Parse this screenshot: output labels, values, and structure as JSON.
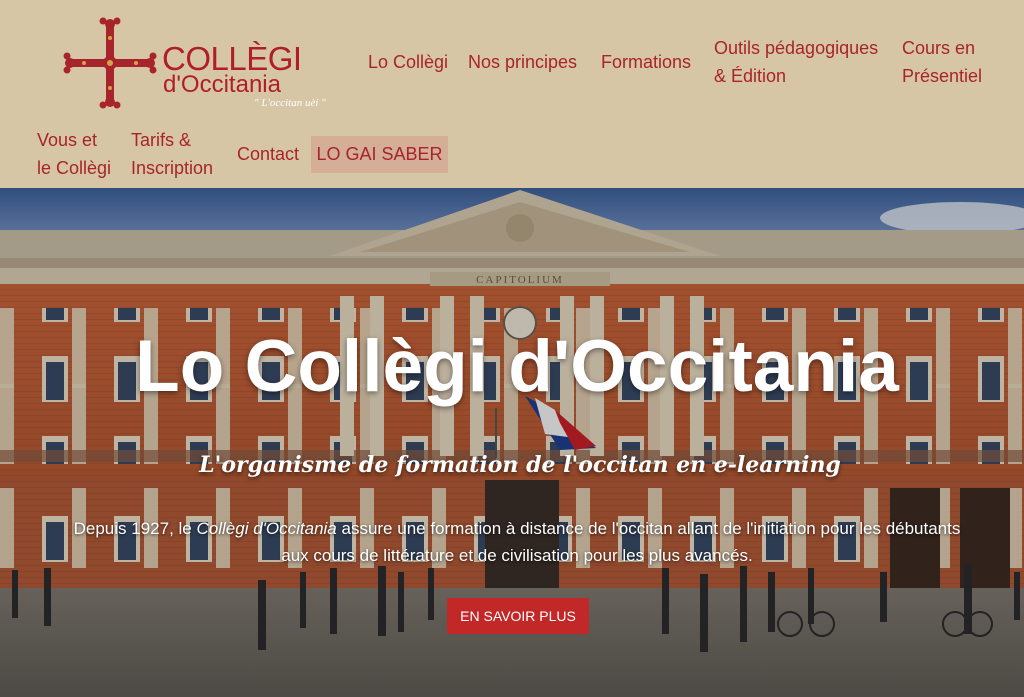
{
  "logo": {
    "line1": "COLLÈGI",
    "line2": "d'Occitania",
    "tagline": "\" L'occitan uèi \""
  },
  "nav": {
    "row1": [
      "Lo Collègi",
      "Nos principes",
      "Formations"
    ],
    "outils": [
      "Outils pédagogiques",
      "& Édition"
    ],
    "cours": [
      "Cours en",
      "Présentiel"
    ],
    "vous": [
      "Vous et",
      "le Collègi"
    ],
    "tarifs": [
      "Tarifs &",
      "Inscription"
    ],
    "contact": "Contact",
    "gai_saber": "LO GAI SABER"
  },
  "hero": {
    "title": "Lo Collègi d'Occitania",
    "subtitle": "L'organisme de formation de l'occitan en e-learning",
    "desc_pre": "Depuis 1927, le ",
    "desc_em": "Collègi d'Occitania",
    "desc_post": " assure une formation à distance de l'occitan allant de l'initiation pour les débutants aux cours de littérature et de civilisation pour les plus avancés.",
    "button": "EN SAVOIR PLUS",
    "facade_inscription": "CAPITOLIUM"
  },
  "colors": {
    "header_bg": "#d7c6a6",
    "brand_red": "#b01e2a",
    "nav_highlight": "#d4ae97",
    "button_red": "#c22828"
  }
}
